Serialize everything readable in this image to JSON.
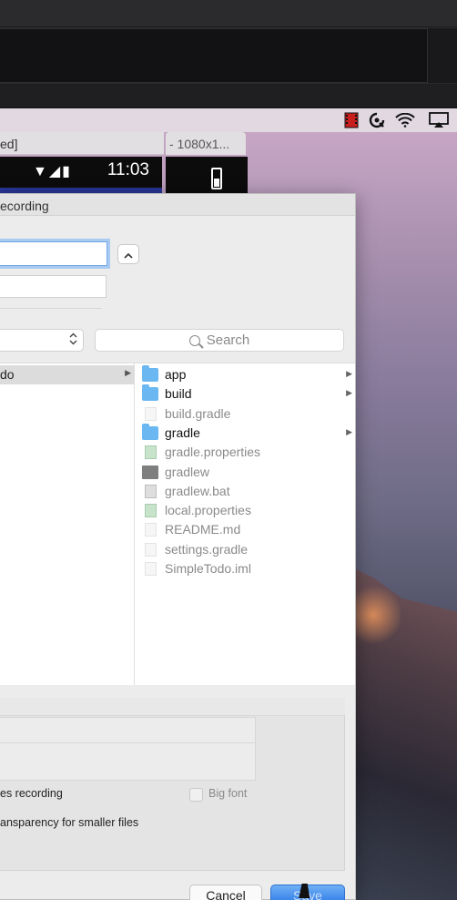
{
  "emulator": {
    "title_fragment": "ed]",
    "clock": "11:03",
    "status_icons": "▼◢▮",
    "second_window_title": "- 1080x1..."
  },
  "menubar": {
    "icons": [
      "film-strip-icon",
      "screen-record-icon",
      "wifi-icon",
      "airplay-icon"
    ]
  },
  "dialog": {
    "title_fragment": "ecording",
    "save_as_value": "",
    "tags_value": "",
    "location_value": "",
    "search_placeholder": "Search",
    "sidebar_selected": "do",
    "files": [
      {
        "name": "app",
        "kind": "folder",
        "has_children": true
      },
      {
        "name": "build",
        "kind": "folder",
        "has_children": true
      },
      {
        "name": "build.gradle",
        "kind": "file",
        "has_children": false
      },
      {
        "name": "gradle",
        "kind": "folder",
        "has_children": true
      },
      {
        "name": "gradle.properties",
        "kind": "file",
        "has_children": false
      },
      {
        "name": "gradlew",
        "kind": "file",
        "has_children": false
      },
      {
        "name": "gradlew.bat",
        "kind": "file",
        "has_children": false
      },
      {
        "name": "local.properties",
        "kind": "file",
        "has_children": false
      },
      {
        "name": "README.md",
        "kind": "file",
        "has_children": false
      },
      {
        "name": "settings.gradle",
        "kind": "file",
        "has_children": false
      },
      {
        "name": "SimpleTodo.iml",
        "kind": "file",
        "has_children": false
      }
    ],
    "options": {
      "recording_label": "es recording",
      "transparency_label": "ansparency for smaller files",
      "big_font_label": "Big font"
    },
    "buttons": {
      "cancel": "Cancel",
      "save": "Save"
    }
  },
  "colors": {
    "accent": "#2f7be8",
    "folder": "#6bb7f2"
  }
}
